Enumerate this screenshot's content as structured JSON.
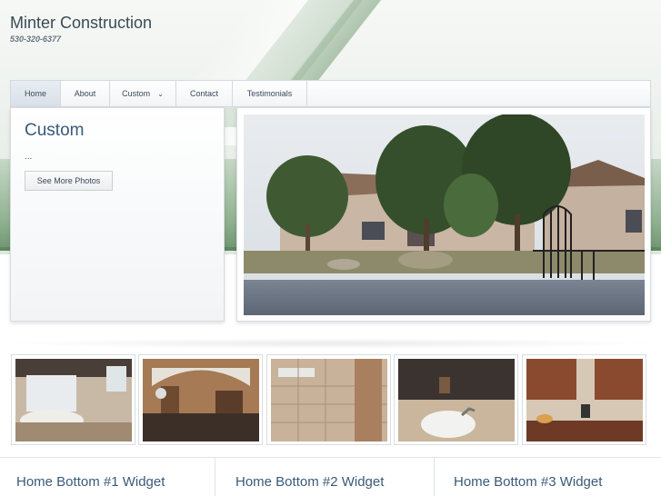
{
  "site": {
    "title": "Minter Construction",
    "phone": "530-320-6377"
  },
  "nav": {
    "items": [
      {
        "label": "Home",
        "active": true
      },
      {
        "label": "About"
      },
      {
        "label": "Custom",
        "has_dropdown": true
      },
      {
        "label": "Contact"
      },
      {
        "label": "Testimonials"
      }
    ],
    "dropdown_icon": "chevron-down-icon"
  },
  "feature": {
    "title": "Custom",
    "excerpt": "...",
    "button_label": "See More Photos"
  },
  "thumbnails": [
    {
      "subject": "bathroom-tub"
    },
    {
      "subject": "kitchen"
    },
    {
      "subject": "tiled-shower"
    },
    {
      "subject": "bathroom-sink"
    },
    {
      "subject": "kitchen-cabinets"
    }
  ],
  "widgets": [
    {
      "title": "Home Bottom #1 Widget"
    },
    {
      "title": "Home Bottom #2 Widget"
    },
    {
      "title": "Home Bottom #3 Widget"
    }
  ],
  "colors": {
    "accent_green": "#6f966f",
    "heading_blue": "#3a5a78",
    "nav_active_bg": "#d8e0e8"
  }
}
